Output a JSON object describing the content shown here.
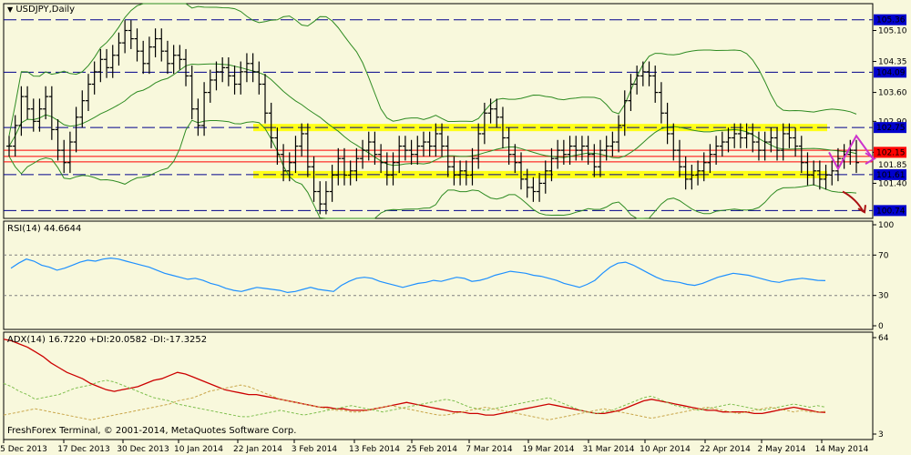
{
  "chart_data": [
    {
      "type": "candlestick",
      "title": "USDJPY,Daily",
      "ylim": [
        100.55,
        105.75
      ],
      "y_ticks": [
        105.1,
        104.35,
        103.6,
        102.9,
        102.15,
        101.4
      ],
      "price_tags": [
        {
          "value": 105.36,
          "text": "105.36",
          "style": "blue"
        },
        {
          "value": 104.09,
          "text": "104.09",
          "style": "blue"
        },
        {
          "value": 102.75,
          "text": "102.75",
          "style": "blue"
        },
        {
          "value": 102.15,
          "text": "102.15",
          "style": "red"
        },
        {
          "value": 101.85,
          "text": "101.85",
          "style": "plain"
        },
        {
          "value": 101.61,
          "text": "101.61",
          "style": "blue"
        },
        {
          "value": 100.74,
          "text": "100.74",
          "style": "blue"
        }
      ],
      "horizontal_lines": [
        105.36,
        104.09,
        102.75,
        101.61,
        100.74
      ],
      "red_lines": [
        102.2,
        102.05,
        101.92
      ],
      "yellow_zones": [
        102.75,
        101.61
      ],
      "closes": [
        102.3,
        102.8,
        103.5,
        103.2,
        102.9,
        103.2,
        103.5,
        102.7,
        102.2,
        101.9,
        102.4,
        103.0,
        103.4,
        103.8,
        104.1,
        104.4,
        104.2,
        104.5,
        104.8,
        105.1,
        104.9,
        104.6,
        104.3,
        104.7,
        104.9,
        104.6,
        104.3,
        104.5,
        104.4,
        104.0,
        103.2,
        102.8,
        103.6,
        103.9,
        104.1,
        104.2,
        104.0,
        103.8,
        104.1,
        104.3,
        104.1,
        103.8,
        103.1,
        102.5,
        102.1,
        101.7,
        101.9,
        102.3,
        102.6,
        101.8,
        101.2,
        100.9,
        101.2,
        101.6,
        102.0,
        101.6,
        101.7,
        102.0,
        102.2,
        102.4,
        102.1,
        101.9,
        101.6,
        101.9,
        102.3,
        102.2,
        102.1,
        102.3,
        102.4,
        102.3,
        102.6,
        102.3,
        101.8,
        101.6,
        101.7,
        101.6,
        102.0,
        102.6,
        103.1,
        103.2,
        103.0,
        102.5,
        102.1,
        101.9,
        101.5,
        101.3,
        101.2,
        101.4,
        101.7,
        102.0,
        102.2,
        102.1,
        102.3,
        102.2,
        102.3,
        102.1,
        101.8,
        102.2,
        102.3,
        102.4,
        102.8,
        103.4,
        103.8,
        104.0,
        104.1,
        104.0,
        103.6,
        103.1,
        102.6,
        102.2,
        101.8,
        101.5,
        101.6,
        101.7,
        101.9,
        102.1,
        102.3,
        102.4,
        102.5,
        102.6,
        102.5,
        102.6,
        102.4,
        102.2,
        102.4,
        102.5,
        102.2,
        102.6,
        102.5,
        102.3,
        101.9,
        101.6,
        101.7,
        101.5,
        101.6,
        101.7,
        102.0,
        102.1,
        102.2,
        101.9
      ],
      "forecast_arrows": [
        {
          "text": "",
          "points": [
            [
              102.15
            ],
            [
              101.75
            ],
            [
              102.55
            ],
            [
              102.0
            ]
          ]
        },
        {
          "text": "",
          "points": [
            [
              101.2
            ],
            [
              100.7
            ]
          ]
        }
      ]
    },
    {
      "type": "line",
      "title": "RSI(14) 44.6644",
      "ylim": [
        0,
        100
      ],
      "y_ticks": [
        100,
        70,
        30,
        0
      ],
      "levels": [
        70,
        30
      ],
      "values": [
        57,
        62,
        66,
        64,
        60,
        58,
        55,
        57,
        60,
        63,
        65,
        64,
        66,
        67,
        66,
        64,
        62,
        60,
        58,
        55,
        52,
        50,
        48,
        46,
        47,
        45,
        42,
        40,
        37,
        35,
        34,
        36,
        38,
        37,
        36,
        35,
        33,
        34,
        36,
        38,
        36,
        35,
        34,
        40,
        44,
        47,
        48,
        47,
        44,
        42,
        40,
        38,
        40,
        42,
        43,
        45,
        44,
        46,
        48,
        47,
        44,
        45,
        47,
        50,
        52,
        54,
        53,
        52,
        50,
        49,
        47,
        45,
        42,
        40,
        38,
        41,
        45,
        52,
        58,
        62,
        63,
        60,
        56,
        52,
        48,
        45,
        44,
        43,
        41,
        40,
        42,
        45,
        48,
        50,
        52,
        51,
        50,
        48,
        46,
        44,
        43,
        45,
        46,
        47,
        46,
        45,
        44.6644
      ]
    },
    {
      "type": "line",
      "title": "ADX(14) 16.7220 +DI:20.0582 -DI:-17.3252",
      "ylim": [
        3,
        64
      ],
      "y_ticks": [
        64,
        3
      ],
      "series": [
        {
          "name": "ADX",
          "values": [
            63,
            62,
            60,
            58,
            55,
            52,
            48,
            45,
            42,
            40,
            38,
            35,
            33,
            31,
            30,
            31,
            32,
            33,
            35,
            37,
            38,
            40,
            42,
            41,
            39,
            37,
            35,
            33,
            31,
            30,
            29,
            28,
            28,
            27,
            26,
            25,
            24,
            23,
            22,
            21,
            20,
            20,
            19,
            19,
            18,
            18,
            18,
            19,
            20,
            21,
            22,
            23,
            22,
            21,
            20,
            19,
            18,
            17,
            17,
            16,
            16,
            15,
            15,
            16,
            17,
            18,
            19,
            20,
            21,
            22,
            21,
            20,
            19,
            18,
            17,
            16,
            16,
            17,
            18,
            20,
            22,
            24,
            25,
            24,
            23,
            22,
            21,
            20,
            19,
            18,
            18,
            17,
            17,
            17,
            17,
            16,
            16,
            17,
            18,
            19,
            20,
            19,
            18,
            17,
            16.722
          ]
        },
        {
          "name": "+DI",
          "values": [
            35,
            33,
            30,
            28,
            25,
            26,
            27,
            28,
            30,
            32,
            33,
            34,
            36,
            37,
            36,
            34,
            32,
            30,
            28,
            26,
            25,
            24,
            22,
            21,
            20,
            19,
            18,
            17,
            16,
            15,
            14,
            14,
            15,
            16,
            17,
            18,
            17,
            16,
            15,
            16,
            17,
            18,
            19,
            20,
            21,
            20,
            19,
            18,
            17,
            18,
            19,
            20,
            21,
            22,
            23,
            24,
            25,
            24,
            22,
            20,
            19,
            18,
            19,
            20,
            21,
            22,
            23,
            24,
            25,
            26,
            24,
            22,
            20,
            18,
            17,
            16,
            17,
            18,
            20,
            22,
            24,
            26,
            27,
            25,
            23,
            21,
            20,
            19,
            18,
            19,
            20,
            21,
            22,
            21,
            20,
            19,
            18,
            19,
            20,
            21,
            22,
            21,
            20,
            21,
            20.0582
          ]
        },
        {
          "name": "-DI",
          "values": [
            15,
            16,
            17,
            18,
            19,
            18,
            17,
            16,
            15,
            14,
            13,
            12,
            13,
            14,
            15,
            16,
            17,
            18,
            19,
            20,
            21,
            22,
            24,
            25,
            26,
            28,
            30,
            31,
            32,
            33,
            34,
            33,
            31,
            29,
            27,
            25,
            24,
            23,
            22,
            21,
            20,
            19,
            18,
            18,
            17,
            17,
            18,
            19,
            20,
            21,
            20,
            19,
            18,
            17,
            16,
            15,
            15,
            16,
            17,
            18,
            19,
            20,
            19,
            18,
            17,
            16,
            15,
            14,
            13,
            12,
            13,
            14,
            15,
            16,
            17,
            18,
            19,
            18,
            17,
            16,
            15,
            14,
            13,
            14,
            15,
            16,
            17,
            18,
            19,
            20,
            19,
            18,
            17,
            16,
            17,
            18,
            19,
            20,
            19,
            18,
            17,
            18,
            17,
            17,
            17.3252
          ]
        }
      ]
    }
  ],
  "x_labels": [
    "5 Dec 2013",
    "17 Dec 2013",
    "30 Dec 2013",
    "10 Jan 2014",
    "22 Jan 2014",
    "3 Feb 2014",
    "13 Feb 2014",
    "25 Feb 2014",
    "7 Mar 2014",
    "19 Mar 2014",
    "31 Mar 2014",
    "10 Apr 2014",
    "22 Apr 2014",
    "2 May 2014",
    "14 May 2014"
  ],
  "footer": "FreshForex Terminal, © 2001-2014, MetaQuotes Software Corp.",
  "colors": {
    "background": "#f8f8dc",
    "grid_line": "#00008b",
    "bollinger": "#2e8b22",
    "yellow_zone": "#ffff00",
    "red_line": "#ff0000",
    "rsi": "#1e90ff",
    "adx": "#cc0000",
    "di_plus": "#7fbf4f",
    "di_minus": "#c9a64a",
    "arrow": "#cc33cc",
    "arrow2": "#aa1111",
    "tag_blue": "#0000cc"
  }
}
